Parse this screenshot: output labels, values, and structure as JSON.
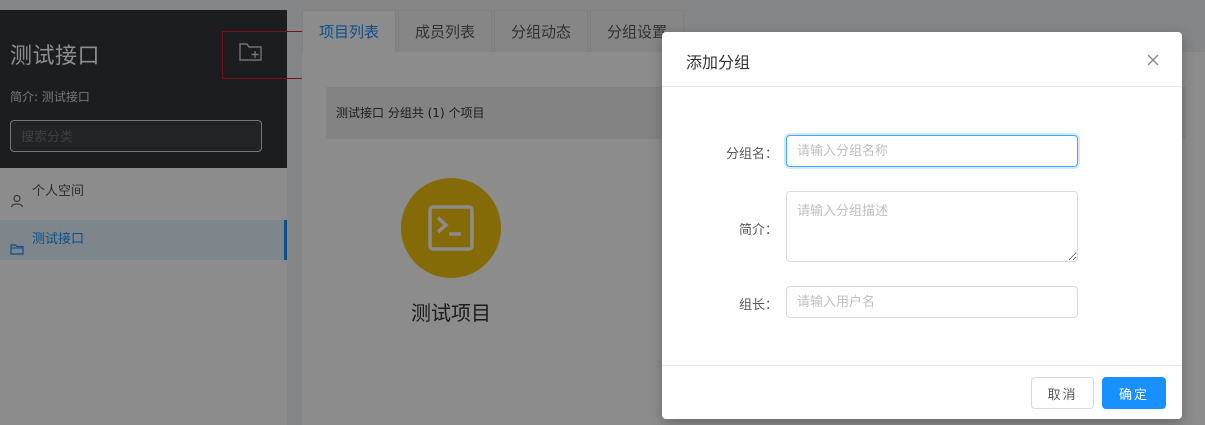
{
  "sidebar": {
    "group_title": "测试接口",
    "group_desc": "简介: 测试接口",
    "search_placeholder": "搜索分类",
    "items": [
      {
        "label": "个人空间",
        "icon": "user-icon"
      },
      {
        "label": "测试接口",
        "icon": "folder-icon"
      }
    ],
    "add_icon": "folder-add-icon"
  },
  "main": {
    "tabs": [
      {
        "label": "项目列表",
        "active": true
      },
      {
        "label": "成员列表",
        "active": false
      },
      {
        "label": "分组动态",
        "active": false
      },
      {
        "label": "分组设置",
        "active": false
      }
    ],
    "summary": "测试接口 分组共 (1) 个项目",
    "project": {
      "name": "测试项目",
      "icon": "terminal-icon",
      "color": "#f1c40f"
    }
  },
  "modal": {
    "title": "添加分组",
    "fields": {
      "name": {
        "label": "分组名：",
        "placeholder": "请输入分组名称",
        "value": ""
      },
      "desc": {
        "label": "简介：",
        "placeholder": "请输入分组描述",
        "value": ""
      },
      "owner": {
        "label": "组长：",
        "placeholder": "请输入用户名",
        "value": ""
      }
    },
    "cancel_label": "取消",
    "ok_label": "确定"
  },
  "colors": {
    "accent": "#1890ff",
    "sidebar_dark": "#32363a",
    "highlight": "#e02020"
  }
}
